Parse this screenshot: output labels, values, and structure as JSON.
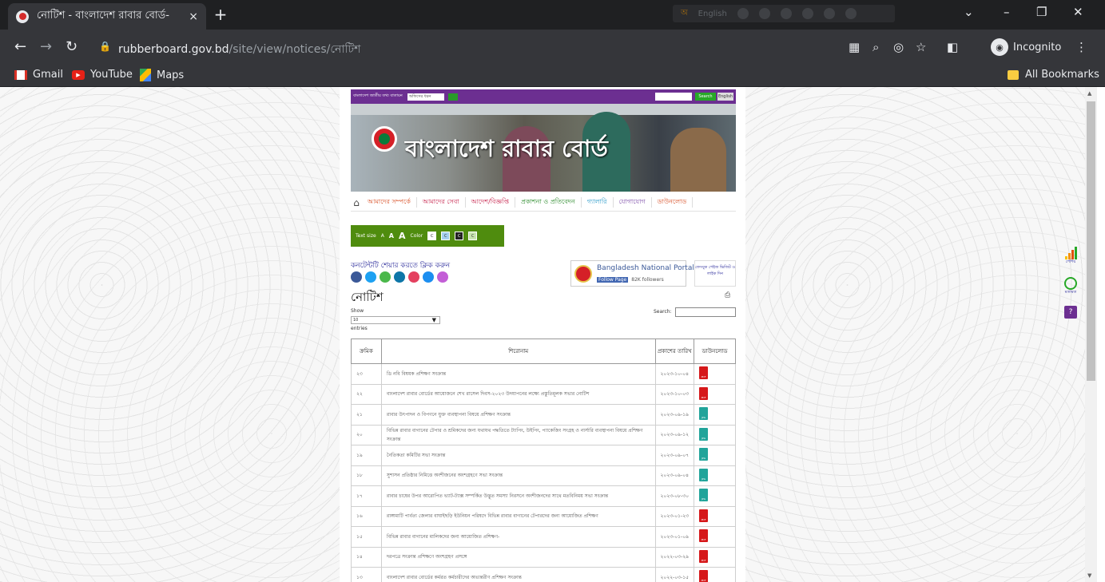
{
  "browser": {
    "tab_title": "নোটিশ - বাংলাদেশ রাবার বোর্ড-",
    "tab_close": "×",
    "new_tab": "+",
    "translate_lang": "English",
    "url_domain": "rubberboard.gov.bd",
    "url_path": "/site/view/notices/নোটিশ",
    "incognito_label": "Incognito",
    "bookmarks": [
      "Gmail",
      "YouTube",
      "Maps"
    ],
    "all_bookmarks": "All Bookmarks"
  },
  "site": {
    "portal_link": "বাংলাদেশ জাতীয় তথ্য বাতায়ন",
    "office_select": "অফিসের ধরন",
    "search_btn": "Search",
    "lang_btn": "English",
    "name": "বাংলাদেশ রাবার বোর্ড",
    "menu": [
      "আমাদের সম্পর্কে",
      "আমাদের সেবা",
      "আদেশ/বিজ্ঞপ্তি",
      "প্রকাশনা ও প্রতিবেদন",
      "গ্যালারি",
      "যোগাযোগ",
      "ডাউনলোড"
    ],
    "text_size_label": "Text size",
    "text_sizes": [
      "A",
      "A",
      "A"
    ],
    "color_label": "Color",
    "color_swatches": [
      "C",
      "C",
      "C",
      "C"
    ],
    "share_label": "কনটেন্টটি শেয়ার করতে ক্লিক করুন",
    "social_colors": [
      "#3b5998",
      "#1da1f2",
      "#4bb84b",
      "#0e76a8",
      "#e4405f",
      "#1c8ef0",
      "#c35ed6"
    ],
    "portal_name": "Bangladesh National Portal",
    "follow_page": "Follow Page",
    "followers": "82K followers",
    "fb_box": "ফেসবুক পেইজ ভিজিট ও লাইক দিন",
    "page_title": "নোটিশ",
    "show_label": "Show",
    "show_value": "10",
    "entries_label": "entries",
    "search_label": "Search:"
  },
  "table": {
    "headers": [
      "ক্রমিক",
      "শিরোনাম",
      "প্রকাশের তারিখ",
      "ডাউনলোড"
    ],
    "rows": [
      {
        "no": "২৩",
        "title": "ডি নবি বিষয়ক প্রশিক্ষণ সংক্রান্ত",
        "date": "২০২৩-১০-০৪",
        "type": "pdf"
      },
      {
        "no": "২২",
        "title": "বাংলাদেশ রাবার বোর্ডের আয়োজনে শেখ রাসেল দিবস-২০২৩ উদযাপনের লক্ষ্যে প্রস্তুতিমূলক সভার নোটিশ",
        "date": "২০২৩-১০-০৩",
        "type": "pdf"
      },
      {
        "no": "২১",
        "title": "রাবার উৎপাদন ও বিপণনে যুক্ত ব্যবস্থাপনা বিষয়ে প্রশিক্ষণ সংক্রান্ত",
        "date": "২০২৩-০৯-১৯",
        "type": "jpg"
      },
      {
        "no": "২০",
        "title": "বিভিন্ন রাবার বাগানের টেপার ও শ্রমিকদের জন্য যথাযথ পদ্ধতিতে ট্যাপিং, উইপিং, প্যাকেজিং সংগ্রহ ও নার্সারি ব্যবস্থাপনা বিষয়ে প্রশিক্ষণ সংক্রান্ত",
        "date": "২০২৩-০৯-১২",
        "type": "jpg"
      },
      {
        "no": "১৯",
        "title": "নৈতিকতা কমিটির সভা সংক্রান্ত",
        "date": "২০২৩-০৯-০৭",
        "type": "jpg"
      },
      {
        "no": "১৮",
        "title": "সুশাসন প্রতিষ্ঠার নিমিত্তে অংশীজনের অংশগ্রহণে সভা সংক্রান্ত",
        "date": "২০২৩-০৯-০৪",
        "type": "jpg"
      },
      {
        "no": "১৭",
        "title": "রাবার চাষের উপর আরোপিত ভ্যাট-ট্যাক্স সম্পর্কিত উদ্ভূত সমস্যা নিরসনে অংশীজনদের সাথে মতবিনিময় সভা সংক্রান্ত",
        "date": "২০২৩-০৮-৩০",
        "type": "jpg"
      },
      {
        "no": "১৬",
        "title": "রাঙ্গামাটি পার্বত্য জেলার বাঘাইছড়ি ইউনিয়ন পরিষদে বিভিন্ন রাবার বাগানের টেপারদের জন্য আয়োজিত প্রশিক্ষণ",
        "date": "২০২৩-০১-২৩",
        "type": "pdf"
      },
      {
        "no": "১৫",
        "title": "বিভিন্ন রাবার বাগানের মালিকদের জন্য আয়োজিত প্রশিক্ষণ-",
        "date": "২০২৩-০১-০৯",
        "type": "pdf"
      },
      {
        "no": "১৪",
        "title": "দরপত্রে সংক্রান্ত প্রশিক্ষণে অংশগ্রহণ প্রসঙ্গে",
        "date": "২০২২-০৩-২৯",
        "type": "pdf"
      },
      {
        "no": "১৩",
        "title": "বাংলাদেশ রাবার বোর্ডের কর্মরত কর্মচারীদের অভ্যন্তরীণ প্রশিক্ষণ সংক্রান্ত",
        "date": "২০২২-০৩-১৫",
        "type": "pdf"
      }
    ]
  },
  "side_widgets": {
    "stats": "পেশিয়",
    "chat": "মতামত"
  }
}
